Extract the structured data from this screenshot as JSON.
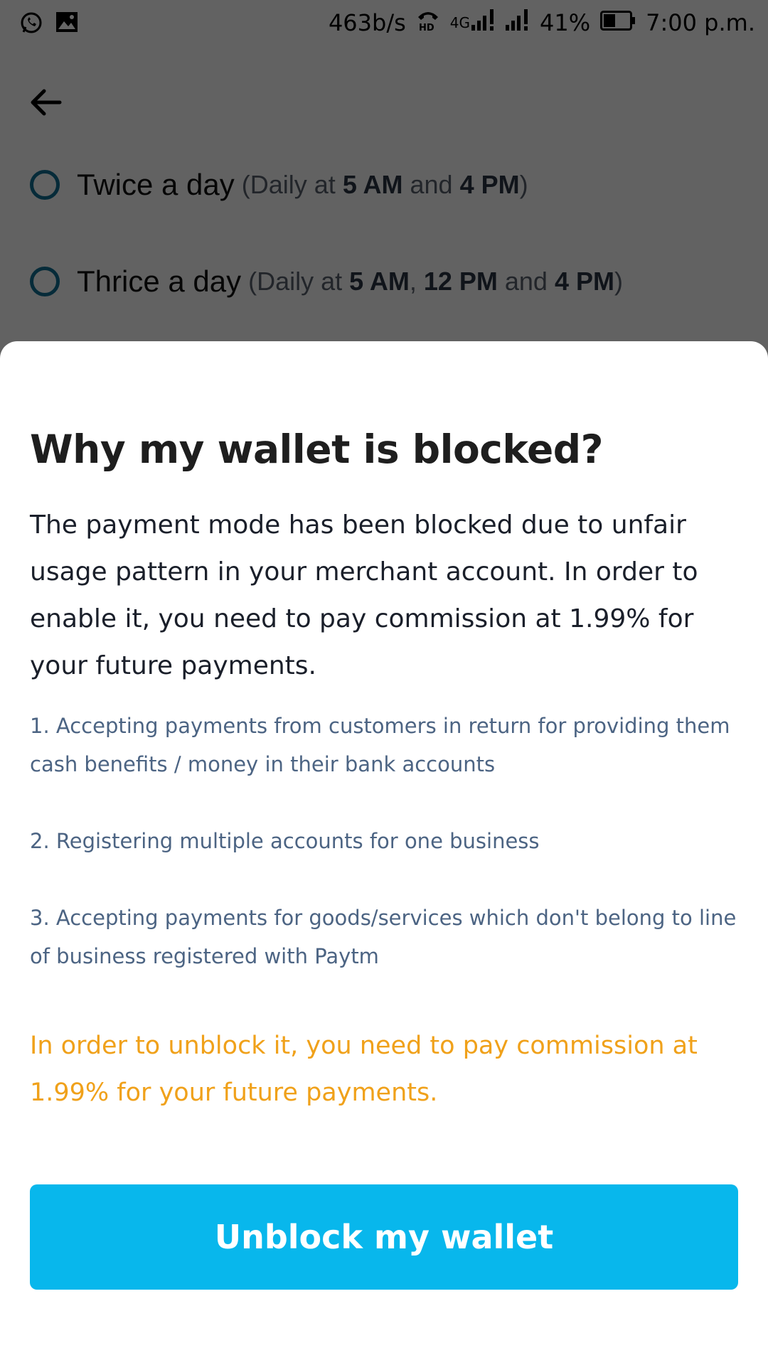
{
  "status_bar": {
    "net_speed": "463b/s",
    "network_type": "4G",
    "hd_label": "HD",
    "battery": "41%",
    "time": "7:00 p.m.",
    "icons": [
      "whatsapp-icon",
      "image-icon",
      "hd-call-icon",
      "signal-icon",
      "signal-icon",
      "battery-icon"
    ]
  },
  "background": {
    "back_icon": "arrow-left-icon",
    "options": [
      {
        "label": "Twice a day",
        "detail_open": "(Daily at ",
        "t1": "5 AM",
        "join1": " and ",
        "t2": "4 PM",
        "detail_close": ")"
      },
      {
        "label": "Thrice a day",
        "detail_open": "(Daily at ",
        "t1": "5 AM",
        "join1": ", ",
        "t2": "12 PM",
        "join2": " and ",
        "t3": "4 PM",
        "detail_close": ")"
      }
    ]
  },
  "sheet": {
    "title": "Why my wallet is blocked?",
    "body": "The payment mode has been blocked due to unfair usage pattern in your merchant account. In order to enable it, you need to pay commission at 1.99% for your future payments.",
    "reasons": [
      "1. Accepting payments from customers in return for providing them cash benefits / money in their bank accounts",
      "2. Registering multiple accounts for one business",
      "3. Accepting payments for goods/services which don't belong to line of business registered with Paytm"
    ],
    "warning": "In order to unblock it, you need to pay commission at 1.99% for your future payments.",
    "button_label": "Unblock my wallet",
    "colors": {
      "button": "#08b7ec",
      "warning": "#f0a11a",
      "reason_text": "#4c6483",
      "radio": "#0f6c8f"
    }
  }
}
